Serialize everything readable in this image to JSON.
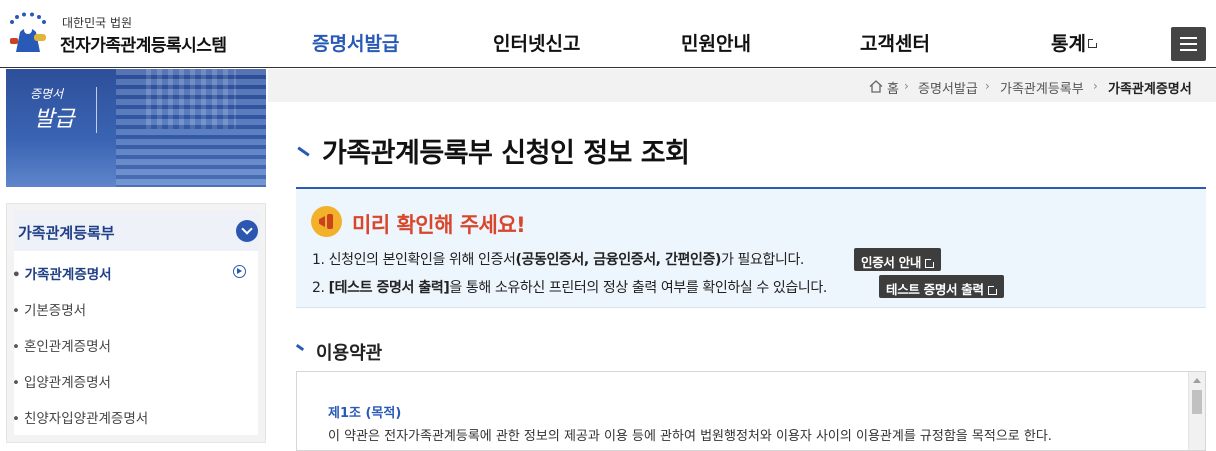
{
  "header": {
    "logo_sub": "대한민국 법원",
    "logo_main": "전자가족관계등록시스템",
    "nav": [
      {
        "label": "증명서발급"
      },
      {
        "label": "인터넷신고"
      },
      {
        "label": "민원안내"
      },
      {
        "label": "고객센터"
      },
      {
        "label": "통계"
      }
    ],
    "active_color": "#2a5ab8"
  },
  "sidebar": {
    "banner_small": "증명서",
    "banner_big": "발급",
    "group_label": "가족관계등록부",
    "items": [
      {
        "label": "가족관계증명서",
        "active": true
      },
      {
        "label": "기본증명서"
      },
      {
        "label": "혼인관계증명서"
      },
      {
        "label": "입양관계증명서"
      },
      {
        "label": "친양자입양관계증명서"
      }
    ]
  },
  "breadcrumb": {
    "home": "홈",
    "items": [
      "증명서발급",
      "가족관계등록부",
      "가족관계증명서"
    ]
  },
  "main": {
    "title": "가족관계등록부 신청인 정보 조회",
    "notice": {
      "title": "미리 확인해 주세요!",
      "line1_pre": "1. 신청인의 본인확인을 위해 인증서",
      "line1_bold": "(공동인증서, 금융인증서, 간편인증)",
      "line1_post": "가 필요합니다.",
      "line1_button": "인증서 안내",
      "line2_pre": "2. ",
      "line2_bold": "[테스트 증명서 출력]",
      "line2_post": "을 통해 소유하신 프린터의 정상 출력 여부를 확인하실 수 있습니다.",
      "line2_button": "테스트 증명서 출력"
    },
    "section_title": "이용약관",
    "terms": {
      "head": "제1조 (목적)",
      "body": "이 약관은 전자가족관계등록에 관한 정보의 제공과 이용 등에 관하여 법원행정처와 이용자 사이의 이용관계를 규정함을 목적으로 한다."
    }
  }
}
